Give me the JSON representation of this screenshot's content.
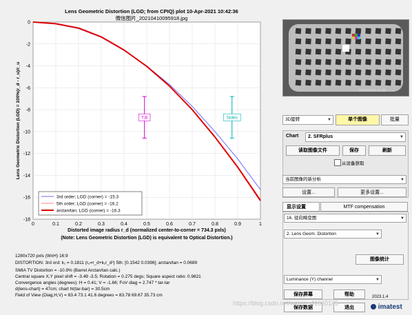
{
  "plot": {
    "title_line1": "Lens Geometric Distortion (LGD; from CPIQ) plot   10-Apr-2021 10:42:36",
    "title_line2": "微信图片_20210410095918.jpg",
    "note": "(Note: Lens Geometric Distortion (LGD) is equivalent to Optical Distortion.)"
  },
  "chart_data": {
    "type": "line",
    "title": "Lens Geometric Distortion (LGD; from CPIQ) plot   10-Apr-2021 10:42:36",
    "xlabel": "Distorted image radius r_d  (normalized center-to-corner = 734.3 pxls)",
    "ylabel": "Lens Geometric Distortion (LGD) = 100%(r_d - r_u)/r_u",
    "xlim": [
      0,
      1
    ],
    "ylim": [
      -18,
      0
    ],
    "xticks": [
      "0",
      "0.1",
      "0.2",
      "0.3",
      "0.4",
      "0.5",
      "0.6",
      "0.7",
      "0.8",
      "0.9",
      "1"
    ],
    "yticks": [
      "0",
      "-2",
      "-4",
      "-6",
      "-8",
      "-10",
      "-12",
      "-14",
      "-16",
      "-18"
    ],
    "grid": true,
    "legend_position": "bottom-left",
    "series": [
      {
        "name": "3rd order;   LGD (corner) = -15.3",
        "color": "#6b6bff",
        "width": 1,
        "x": [
          0,
          0.1,
          0.2,
          0.3,
          0.4,
          0.5,
          0.6,
          0.7,
          0.8,
          0.9,
          1.0
        ],
        "y": [
          0,
          -0.18,
          -0.6,
          -1.4,
          -2.6,
          -4.0,
          -5.7,
          -7.7,
          -10.0,
          -12.5,
          -15.3
        ]
      },
      {
        "name": "5th order;   LGD (corner) = -16.2",
        "color": "#ff8080",
        "width": 1,
        "x": [
          0,
          0.1,
          0.2,
          0.3,
          0.4,
          0.5,
          0.6,
          0.7,
          0.8,
          0.9,
          1.0
        ],
        "y": [
          0,
          -0.15,
          -0.55,
          -1.35,
          -2.55,
          -4.05,
          -5.85,
          -8.0,
          -10.45,
          -13.2,
          -16.2
        ]
      },
      {
        "name": "arctan/tan;  LGD (corner) = -16.3",
        "color": "#e00000",
        "width": 2,
        "x": [
          0,
          0.1,
          0.2,
          0.3,
          0.4,
          0.5,
          0.6,
          0.7,
          0.8,
          0.9,
          1.0
        ],
        "y": [
          0,
          -0.15,
          -0.55,
          -1.35,
          -2.55,
          -4.05,
          -5.85,
          -8.0,
          -10.5,
          -13.25,
          -16.3
        ]
      }
    ],
    "markers": [
      {
        "label": "T,B",
        "x": 0.49,
        "color": "#d000d0"
      },
      {
        "label": "Sides",
        "x": 0.875,
        "color": "#00b0b0"
      }
    ]
  },
  "info_lines": [
    "1280x720 pxls (WxH) 16:9",
    "DISTORTION:  3rd ord: k₁ = 0.1811  (rᵤ=r_d+k₁r_d³)    5th: [0.1542  0.0396];   arctan/tan = 0.0689",
    "SMIA TV Distortion = -10.9%  (Barrel   Arctan/tan calc.)",
    "Central square X,Y pixel shift = -3.49  -3.5;  Rotation = 0.275 degs;  Square aspect ratio: 0.9821",
    "Convergence angles (degrees):  H = 0.41;  V = -1.66;  FoV diag = 2.747 * tar-tar",
    "d(lens-chart) = 47cm;  chart ht(tar-bar) = 30.5cm",
    "Field of View (Diag,H,V) = 83.4     73.1     41.6 degrees  =  83.78     69.67     35.73 cm"
  ],
  "thumbnail": {
    "caption": "2021/04/10 10:38"
  },
  "panel": {
    "mode_select": "3D旋转",
    "single_image_btn": "单个图像",
    "batch_btn": "批量",
    "chart_label": "Chart",
    "chart_select": "2. SFRplus",
    "read_image_btn": "读取图像文件",
    "save_btn": "保存",
    "refresh_btn": "刷新",
    "device_checkbox": "从设备获取",
    "current_image_select": "当前图像的新分析",
    "settings_btn": "设置...",
    "more_settings_btn": "更多设置...",
    "tab_display": "显示设置",
    "tab_mtf": "MTF compensation",
    "display_select": "16. 径向畸变图",
    "sub_select": "2. Lens Geom. Distortion",
    "image_stats_btn": "图像统计",
    "channel_select": "Luminance (Y) channel",
    "save_screen_btn": "保存屏幕",
    "help_btn": "帮助",
    "save_data_btn": "保存数据",
    "exit_btn": "退出",
    "version": "2023.1.4",
    "brand": "imatest",
    "watermark": "https://blog.csdn.net/weixin_41660145"
  }
}
